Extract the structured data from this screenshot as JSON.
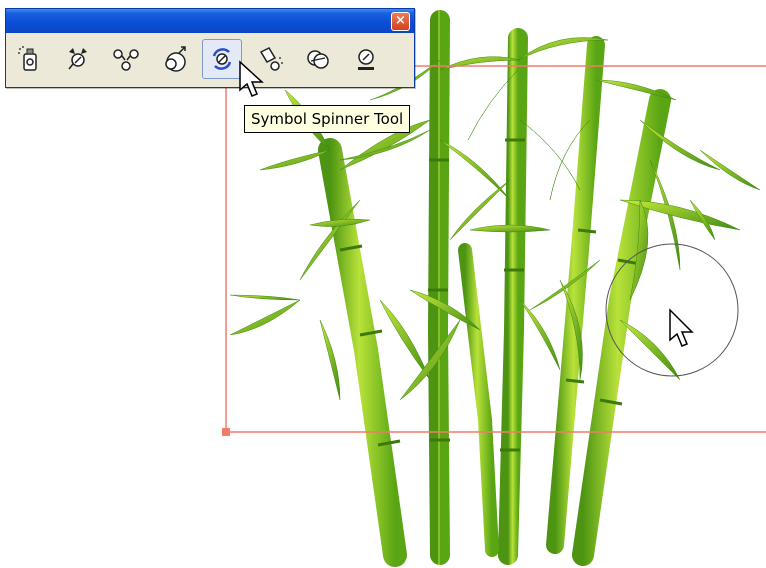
{
  "toolpanel": {
    "close_label": "×",
    "tools": [
      {
        "name": "symbol-sprayer-tool",
        "active": false
      },
      {
        "name": "symbol-shifter-tool",
        "active": false
      },
      {
        "name": "symbol-scruncher-tool",
        "active": false
      },
      {
        "name": "symbol-sizer-tool",
        "active": false
      },
      {
        "name": "symbol-spinner-tool",
        "active": true
      },
      {
        "name": "symbol-stainer-tool",
        "active": false
      },
      {
        "name": "symbol-screener-tool",
        "active": false
      },
      {
        "name": "symbol-styler-tool",
        "active": false
      }
    ]
  },
  "tooltip": {
    "text": "Symbol Spinner Tool"
  },
  "colors": {
    "title_blue": "#0a4fd6",
    "close_red": "#d2411f",
    "bounding_box": "#f07c6a",
    "bamboo_light": "#b6e02a",
    "bamboo_dark": "#4f9a12"
  },
  "icons": {
    "close": "close-icon",
    "pointer": "arrow-pointer-cursor",
    "brush": "symbol-brush-cursor"
  }
}
